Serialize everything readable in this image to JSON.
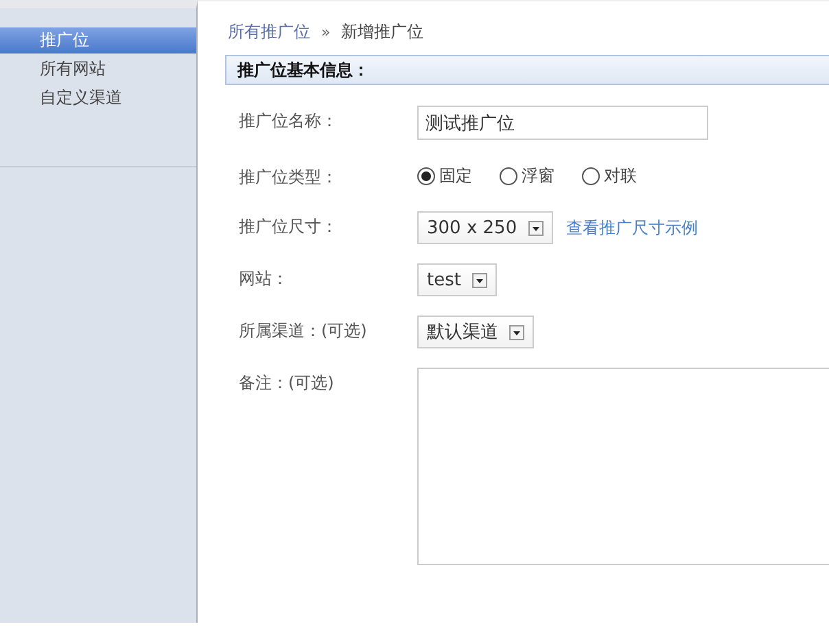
{
  "sidebar": {
    "items": [
      {
        "label": "推广位",
        "selected": true
      },
      {
        "label": "所有网站",
        "selected": false
      },
      {
        "label": "自定义渠道",
        "selected": false
      }
    ]
  },
  "breadcrumb": {
    "link": "所有推广位",
    "separator": "»",
    "current": "新增推广位"
  },
  "section_title": "推广位基本信息：",
  "fields": [
    {
      "kind": "text",
      "label": "推广位名称：",
      "value": "测试推广位"
    },
    {
      "kind": "radio",
      "label": "推广位类型：",
      "options": [
        {
          "label": "固定",
          "selected": true
        },
        {
          "label": "浮窗",
          "selected": false
        },
        {
          "label": "对联",
          "selected": false
        }
      ]
    },
    {
      "kind": "select",
      "label": "推广位尺寸：",
      "value": "300 x 250",
      "link": "查看推广尺寸示例"
    },
    {
      "kind": "select",
      "label": "网站：",
      "value": "test"
    },
    {
      "kind": "select",
      "label": "所属渠道：(可选)",
      "value": "默认渠道"
    },
    {
      "kind": "textarea",
      "label": "备注：(可选)"
    }
  ]
}
